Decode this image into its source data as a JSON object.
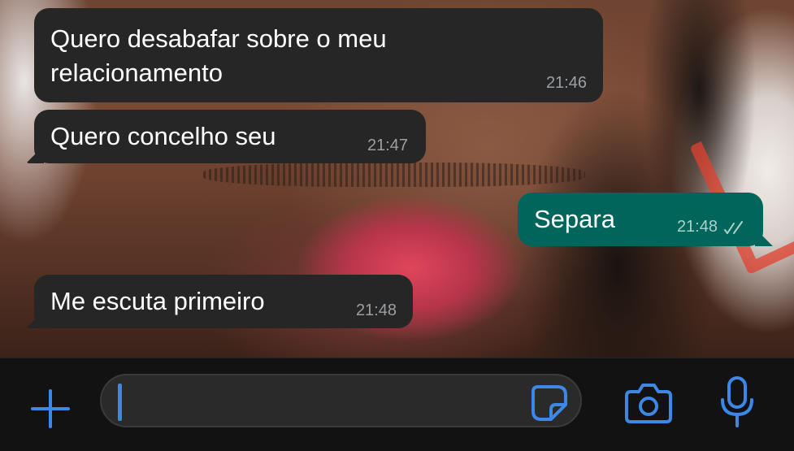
{
  "messages": [
    {
      "direction": "incoming",
      "text": "Quero desabafar sobre o meu\nrelacionamento",
      "time": "21:46"
    },
    {
      "direction": "incoming",
      "text": "Quero concelho seu",
      "time": "21:47"
    },
    {
      "direction": "outgoing",
      "text": "Separa",
      "time": "21:48",
      "status": "read"
    },
    {
      "direction": "incoming",
      "text": "Me escuta primeiro",
      "time": "21:48"
    }
  ],
  "composer": {
    "value": "",
    "icons": [
      "plus-icon",
      "sticker-icon",
      "camera-icon",
      "microphone-icon"
    ]
  },
  "colors": {
    "incoming_bubble": "#262626",
    "outgoing_bubble": "#00665c",
    "accent": "#3d87e6",
    "bar": "#121212"
  }
}
